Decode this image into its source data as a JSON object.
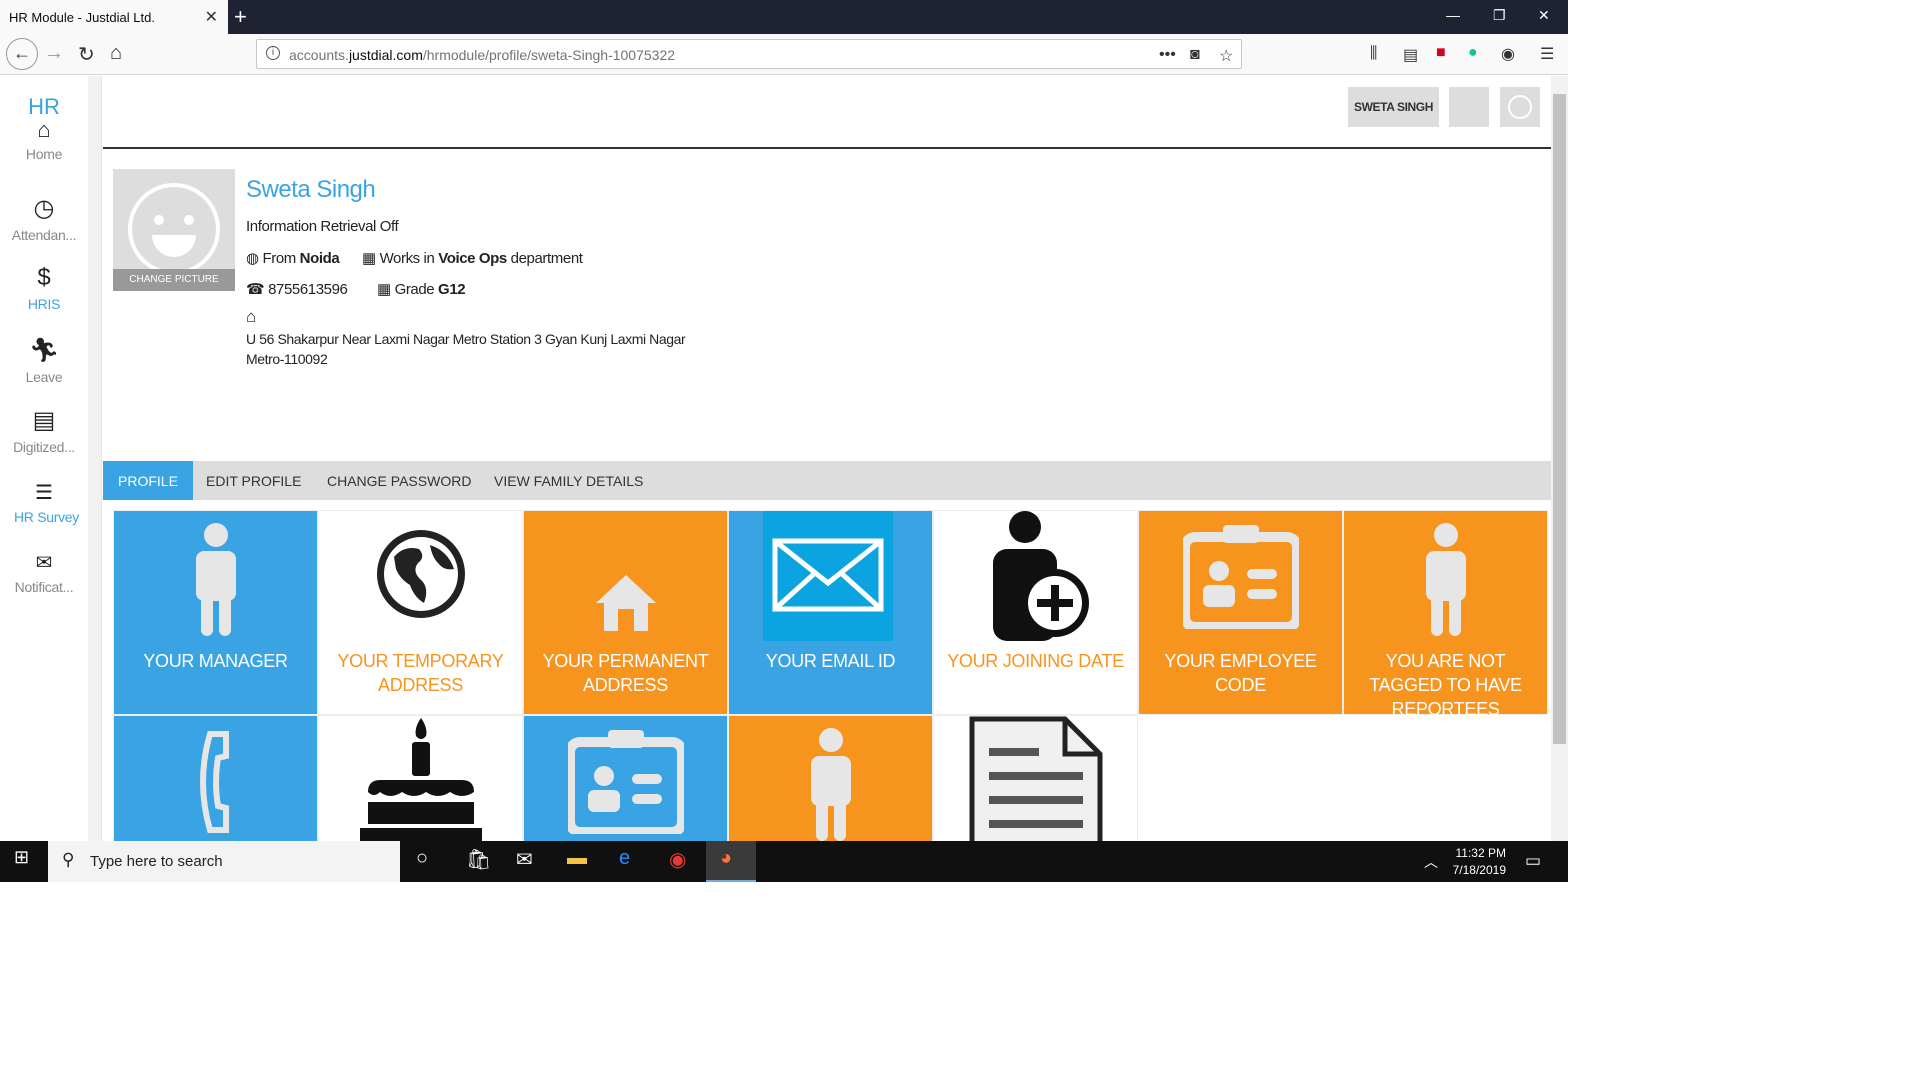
{
  "browser": {
    "tab_title": "HR Module - Justdial Ltd.",
    "url_prefix": "accounts.",
    "url_domain": "justdial.com",
    "url_path": "/hrmodule/profile/sweta-Singh-10075322"
  },
  "sidebar": {
    "brand": "HR",
    "items": [
      {
        "label": "Home",
        "icon": "home-icon"
      },
      {
        "label": "Attendan...",
        "icon": "clock-icon"
      },
      {
        "label": "HRIS",
        "icon": "money-hand-icon"
      },
      {
        "label": "Leave",
        "icon": "running-icon"
      },
      {
        "label": "Digitized...",
        "icon": "document-icon"
      },
      {
        "label": "HR Survey",
        "icon": "checklist-icon"
      },
      {
        "label": "Notificat...",
        "icon": "mail-icon"
      }
    ]
  },
  "header": {
    "user_name": "SWETA SINGH"
  },
  "profile": {
    "change_picture": "CHANGE PICTURE",
    "name": "Sweta Singh",
    "designation": "Information Retrieval Off",
    "from_prefix": "From",
    "from_city": "Noida",
    "works_prefix": "Works in",
    "department": "Voice Ops",
    "works_suffix": "department",
    "phone": "8755613596",
    "grade_prefix": "Grade",
    "grade": "G12",
    "address_line1": "U 56 Shakarpur Near Laxmi Nagar Metro Station 3 Gyan Kunj Laxmi Nagar",
    "address_line2": "Metro-110092"
  },
  "tabs": [
    "PROFILE",
    "EDIT PROFILE",
    "CHANGE PASSWORD",
    "VIEW FAMILY DETAILS"
  ],
  "tiles_row1": [
    {
      "label": "YOUR MANAGER",
      "bg": "#3aa3e3",
      "fg": "#ffffff",
      "icon": "person-icon"
    },
    {
      "label": "YOUR TEMPORARY ADDRESS",
      "bg": "#ffffff",
      "fg": "#f7941d",
      "icon": "globe-icon"
    },
    {
      "label": "YOUR PERMANENT ADDRESS",
      "bg": "#f7941d",
      "fg": "#ffffff",
      "icon": "house-icon"
    },
    {
      "label": "YOUR EMAIL ID",
      "bg": "#3aa3e3",
      "fg": "#ffffff",
      "icon": "envelope-icon"
    },
    {
      "label": "YOUR JOINING DATE",
      "bg": "#ffffff",
      "fg": "#f7941d",
      "icon": "add-person-icon"
    },
    {
      "label": "YOUR EMPLOYEE CODE",
      "bg": "#f7941d",
      "fg": "#ffffff",
      "icon": "id-card-icon"
    },
    {
      "label": "YOU ARE NOT TAGGED TO HAVE REPORTEES",
      "bg": "#f7941d",
      "fg": "#ffffff",
      "icon": "person-icon"
    }
  ],
  "tiles_row2": [
    {
      "bg": "#3aa3e3",
      "icon": "phone-icon"
    },
    {
      "bg": "#ffffff",
      "icon": "cake-icon"
    },
    {
      "bg": "#3aa3e3",
      "icon": "id-card-icon"
    },
    {
      "bg": "#f7941d",
      "icon": "person-icon"
    },
    {
      "bg": "#ffffff",
      "icon": "document-icon"
    }
  ],
  "taskbar": {
    "search_placeholder": "Type here to search",
    "time": "11:32 PM",
    "date": "7/18/2019"
  }
}
